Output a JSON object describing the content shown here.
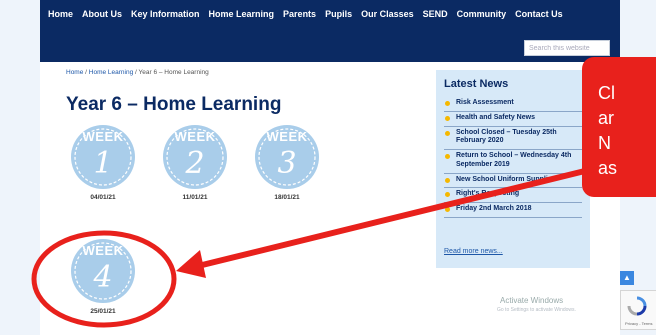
{
  "nav": {
    "items": [
      "Home",
      "About Us",
      "Key Information",
      "Home Learning",
      "Parents",
      "Pupils",
      "Our Classes",
      "SEND",
      "Community",
      "Contact Us"
    ],
    "search_placeholder": "Search this website"
  },
  "breadcrumb": {
    "home": "Home",
    "home_learning": "Home Learning",
    "sep": " / ",
    "current": "Year 6 – Home Learning"
  },
  "page_title": "Year 6 – Home Learning",
  "weeks": [
    {
      "label": "WEEK",
      "number": "1",
      "date": "04/01/21"
    },
    {
      "label": "WEEK",
      "number": "2",
      "date": "11/01/21"
    },
    {
      "label": "WEEK",
      "number": "3",
      "date": "18/01/21"
    },
    {
      "label": "WEEK",
      "number": "4",
      "date": "25/01/21"
    }
  ],
  "latest_news": {
    "title": "Latest News",
    "items": [
      "Risk Assessment",
      "Health and Safety News",
      "School Closed – Tuesday 25th February 2020",
      "Return to School – Wednesday 4th September 2019",
      "New School Uniform Supplier",
      "Right's Respecting",
      "Friday 2nd March 2018"
    ],
    "more": "Read more news..."
  },
  "callout": {
    "lines": [
      "Cl",
      "ar",
      "N",
      "as"
    ]
  },
  "windows_notice": {
    "title": "Activate Windows",
    "subtitle": "Go to Settings to activate Windows."
  },
  "recaptcha": {
    "text": "Privacy - Terms"
  },
  "icons": {
    "scroll_top": "chevron-up-icon",
    "recaptcha": "recaptcha-icon",
    "news_bullet": "bullet-dot-icon"
  },
  "colors": {
    "nav_bg": "#0b2a63",
    "title": "#0b2a63",
    "badge": "#a9cdea",
    "news_bg": "#d7e9f8",
    "annotation_red": "#e8211c"
  }
}
